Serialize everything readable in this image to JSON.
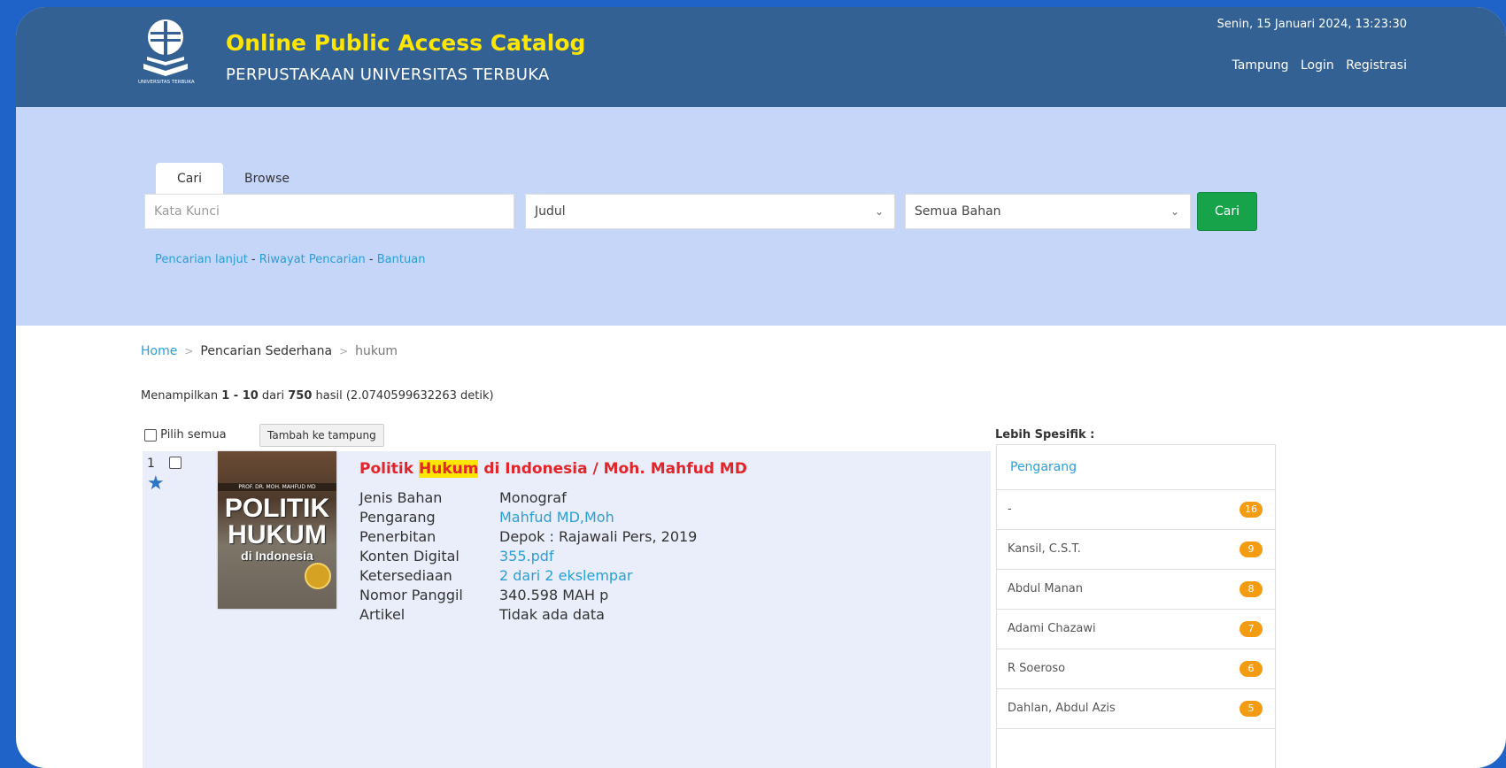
{
  "header": {
    "title": "Online Public Access Catalog",
    "subtitle": "PERPUSTAKAAN UNIVERSITAS TERBUKA",
    "logo_caption": "UNIVERSITAS TERBUKA",
    "datetime": "Senin, 15 Januari 2024, 13:23:30",
    "links": [
      "Tampung",
      "Login",
      "Registrasi"
    ]
  },
  "search": {
    "tabs": [
      "Cari",
      "Browse"
    ],
    "keyword_placeholder": "Kata Kunci",
    "field_select": "Judul",
    "type_select": "Semua Bahan",
    "submit_label": "Cari",
    "sublinks": [
      "Pencarian lanjut",
      "Riwayat Pencarian",
      "Bantuan"
    ],
    "sublink_sep": " - "
  },
  "breadcrumb": [
    "Home",
    "Pencarian Sederhana",
    "hukum"
  ],
  "summary": {
    "prefix": "Menampilkan ",
    "range": "1 - 10",
    "mid": " dari ",
    "total": "750",
    "suffix": " hasil (2.0740599632263 detik)"
  },
  "toolbar": {
    "select_all_label": "Pilih semua",
    "add_to_cart_label": "Tambah ke tampung"
  },
  "results": [
    {
      "number": "1",
      "title_before": "Politik ",
      "title_highlight": "Hukum",
      "title_after": " di Indonesia / Moh. Mahfud MD",
      "cover": {
        "author": "PROF. DR. MOH. MAHFUD MD",
        "line1": "POLITIK",
        "line2": "HUKUM",
        "line3": "di Indonesia"
      },
      "fields": [
        {
          "label": "Jenis Bahan",
          "value": "Monograf",
          "link": false
        },
        {
          "label": "Pengarang",
          "value": "Mahfud MD,Moh",
          "link": true
        },
        {
          "label": "Penerbitan",
          "value": "Depok : Rajawali Pers, 2019",
          "link": false
        },
        {
          "label": "Konten Digital",
          "value": "355.pdf",
          "link": true
        },
        {
          "label": "Ketersediaan",
          "value": "2 dari 2 ekslempar",
          "link": true
        },
        {
          "label": "Nomor Panggil",
          "value": "340.598 MAH p",
          "link": false
        },
        {
          "label": "Artikel",
          "value": "Tidak ada data",
          "link": false
        }
      ]
    }
  ],
  "facets": {
    "title": "Lebih Spesifik :",
    "group": "Pengarang",
    "items": [
      {
        "label": "-",
        "count": "16"
      },
      {
        "label": "Kansil, C.S.T.",
        "count": "9"
      },
      {
        "label": "Abdul Manan",
        "count": "8"
      },
      {
        "label": "Adami Chazawi",
        "count": "7"
      },
      {
        "label": "R Soeroso",
        "count": "6"
      },
      {
        "label": "Dahlan, Abdul Azis",
        "count": "5"
      }
    ]
  },
  "colors": {
    "background": "#1f63c9",
    "header": "#336194",
    "title_yellow": "#ffe600",
    "search_band": "#c6d6f9",
    "link_blue": "#2a9fd6",
    "result_title_red": "#e0252b",
    "button_green": "#17a34a",
    "badge_orange": "#f39c12"
  }
}
